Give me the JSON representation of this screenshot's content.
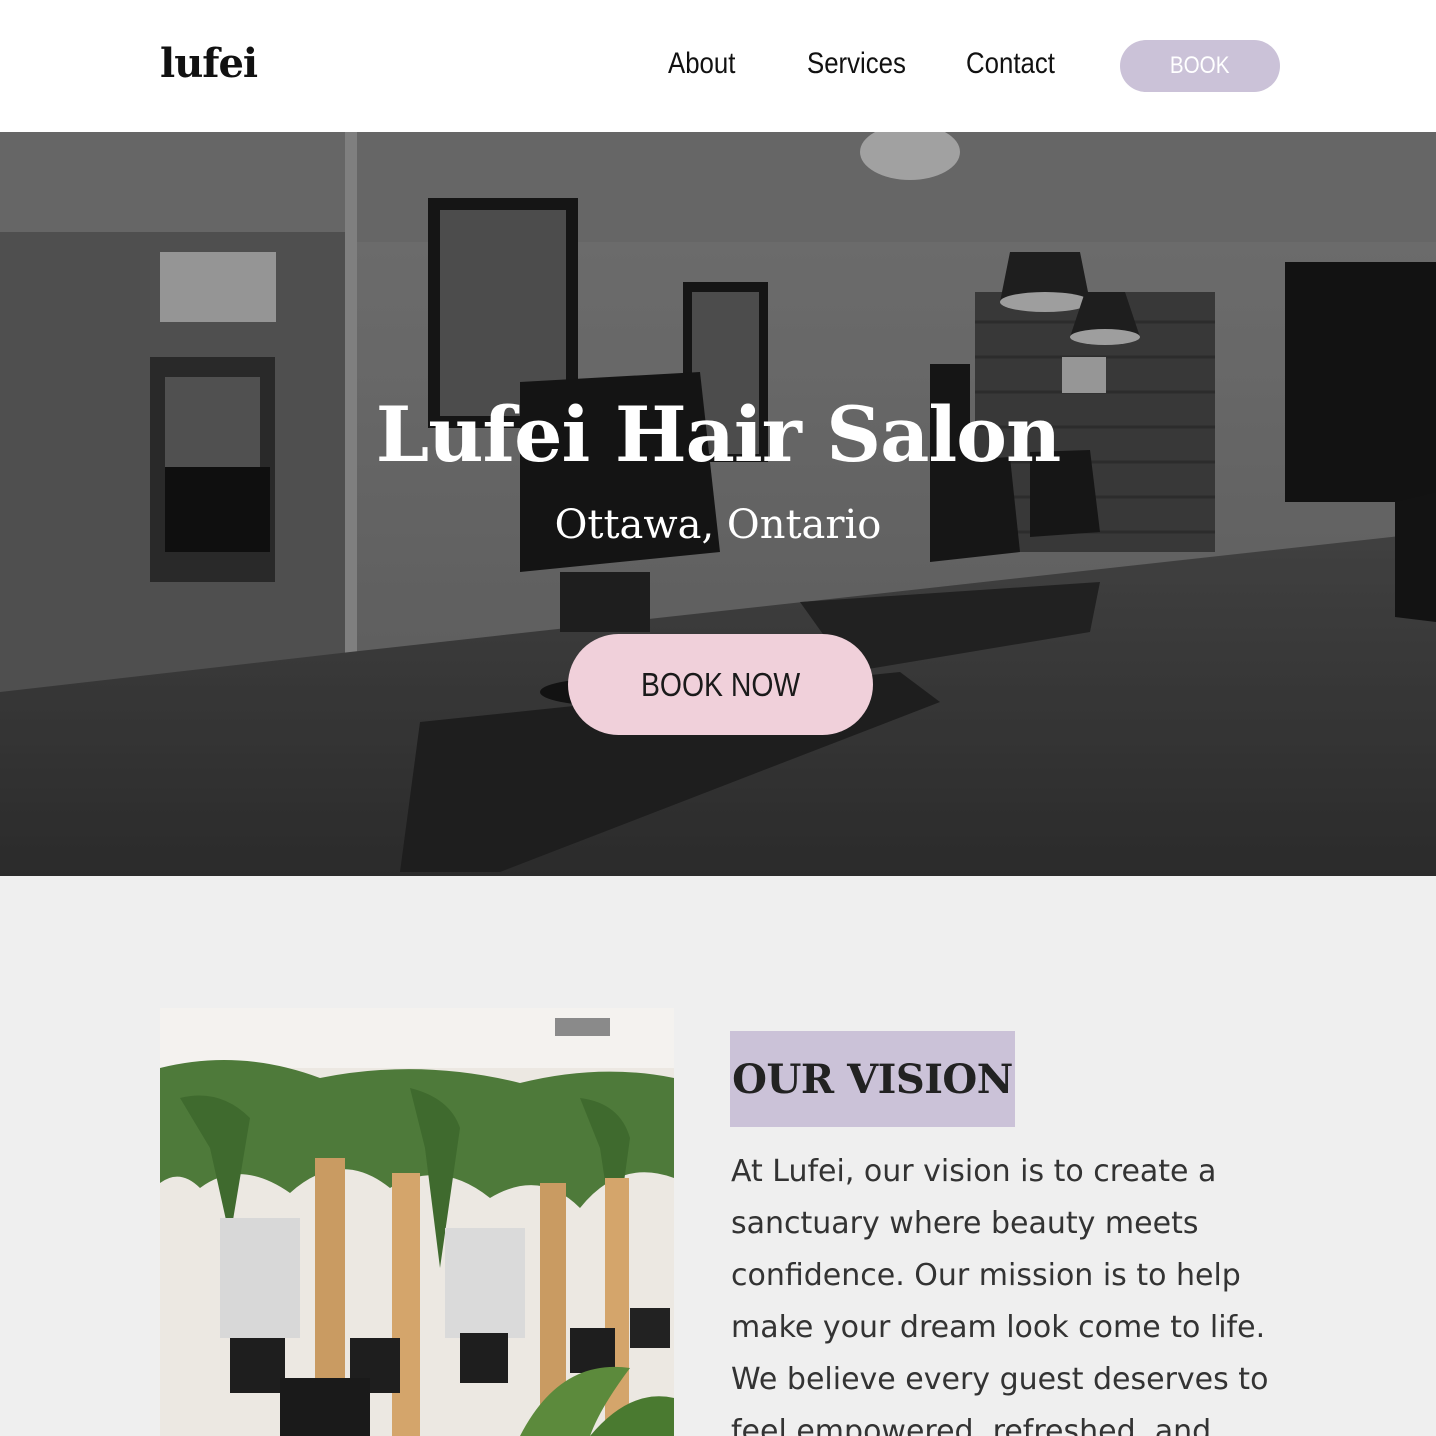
{
  "header": {
    "logo": "lufei",
    "nav": {
      "about": "About",
      "services": "Services",
      "contact": "Contact"
    },
    "book_label": "BOOK",
    "book_color": "#cbc2d8"
  },
  "hero": {
    "title": "Lufei Hair Salon",
    "subtitle": "Ottawa, Ontario",
    "cta_label": "BOOK NOW",
    "cta_color": "#f0d0da"
  },
  "vision": {
    "heading": "OUR VISION",
    "body": "At Lufei, our vision is to create a sanctuary where beauty meets confidence. Our mission is to help make your dream look come to life. We believe every guest deserves to feel empowered, refreshed, and"
  }
}
